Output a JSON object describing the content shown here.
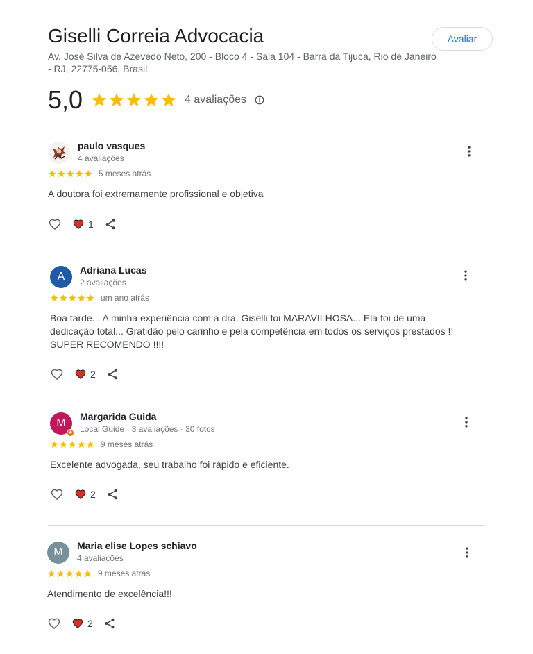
{
  "business": {
    "name": "Giselli Correia Advocacia",
    "address": "Av. José Silva de Azevedo Neto, 200 - Bloco 4 - Sala 104 - Barra da Tijuca, Rio de Janeiro - RJ, 22775-056, Brasil",
    "rating": "5,0",
    "stars": 5,
    "review_count": "4 avaliações",
    "rate_button": "Avaliar"
  },
  "colors": {
    "star": "#fbbc04",
    "heart": "#d93025",
    "link": "#1a73e8"
  },
  "reviews": [
    {
      "name": "paulo vasques",
      "meta": "4 avaliações",
      "stars": 5,
      "date": "5 meses atrás",
      "text": "A doutora foi extremamente profissional e objetiva",
      "likes": "1",
      "avatar": {
        "type": "image",
        "icon": "illustrated-avatar"
      }
    },
    {
      "name": "Adriana Lucas",
      "meta": "2 avaliações",
      "stars": 5,
      "date": "um ano atrás",
      "text": "Boa tarde... A minha experiência com a dra. Giselli foi MARAVILHOSA... Ela foi de uma dedicação total... Gratidão pelo carinho e pela competência em todos os serviços prestados !! SUPER RECOMENDO !!!!",
      "likes": "2",
      "avatar": {
        "type": "letter",
        "letter": "A",
        "color": "#1e5aa8"
      }
    },
    {
      "name": "Margarida Guida",
      "meta": "Local Guide · 3 avaliações · 30 fotos",
      "stars": 5,
      "date": "9 meses atrás",
      "text": "Excelente advogada, seu trabalho foi rápido e eficiente.",
      "likes": "2",
      "avatar": {
        "type": "letter",
        "letter": "M",
        "color": "#c2185b",
        "badge": "local-guide-star-icon"
      }
    },
    {
      "name": "Maria elise Lopes schiavo",
      "meta": "4 avaliações",
      "stars": 5,
      "date": "9 meses atrás",
      "text": "Atendimento de excelência!!!",
      "likes": "2",
      "avatar": {
        "type": "letter",
        "letter": "M",
        "color": "#78909c"
      }
    }
  ]
}
